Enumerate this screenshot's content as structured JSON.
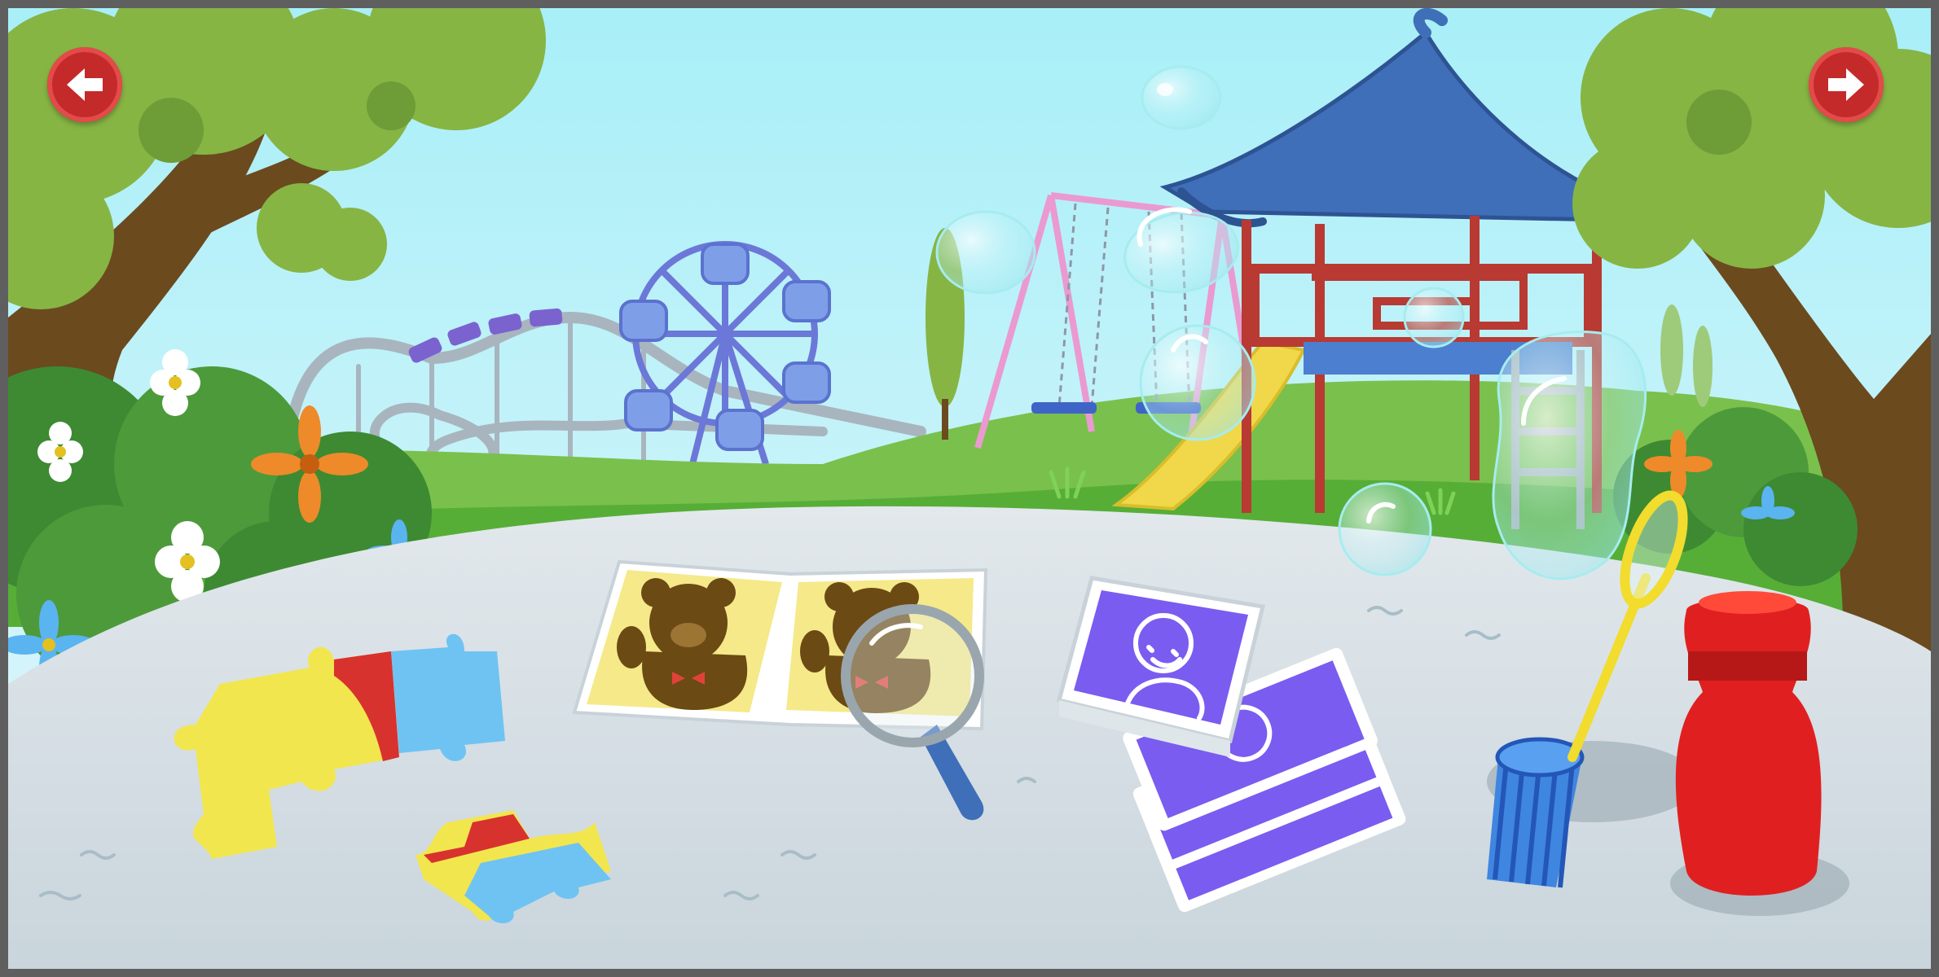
{
  "scene": {
    "navigation": {
      "back_icon": "arrow-left-icon",
      "next_icon": "arrow-right-icon"
    },
    "colors": {
      "sky": "#aef0f8",
      "grass": "#5cb53b",
      "table": "#dde5ea",
      "nav_button": "#c42a2a",
      "card_purple": "#7a5cf0",
      "puzzle_yellow": "#f2e64e",
      "puzzle_blue": "#6fc3f2",
      "puzzle_red": "#d8322e",
      "bottle_red": "#e02020",
      "book_yellow": "#f5e98a",
      "bear_brown": "#6b4a14",
      "pavilion_roof": "#3f6fb8",
      "pavilion_frame": "#b83a32"
    },
    "objects": [
      {
        "id": "puzzle-pieces",
        "icon": "puzzle-piece-icon"
      },
      {
        "id": "picture-book",
        "icon": "book-icon"
      },
      {
        "id": "magnifying-glass",
        "icon": "magnifier-icon"
      },
      {
        "id": "picture-cards",
        "icon": "card-stack-icon"
      },
      {
        "id": "bubble-wand",
        "icon": "bubble-wand-icon"
      },
      {
        "id": "bubble-bottle",
        "icon": "bottle-icon"
      }
    ]
  }
}
